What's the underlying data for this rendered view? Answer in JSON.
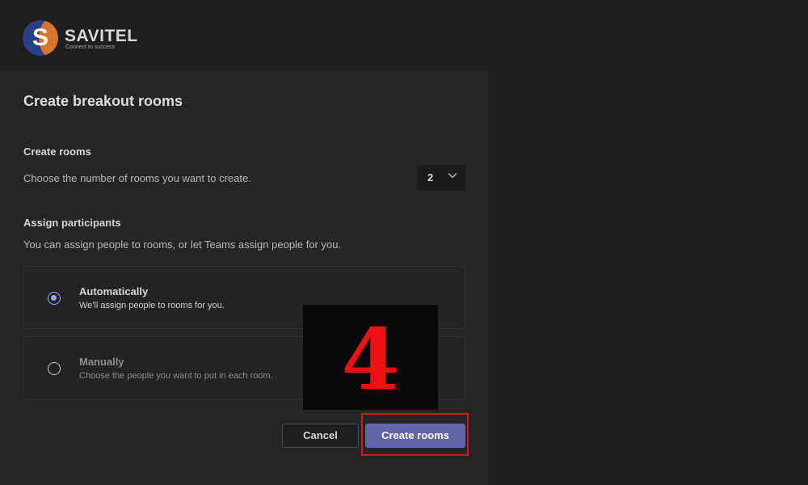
{
  "brand": {
    "logo_letter": "S",
    "name": "SAVITEL",
    "tagline": "Connect to success",
    "colors": {
      "primary": "#2a3f86",
      "secondary": "#d9732d"
    }
  },
  "dialog": {
    "title": "Create breakout rooms",
    "create_rooms": {
      "label": "Create rooms",
      "description": "Choose the number of rooms you want to create.",
      "selected_count": "2",
      "chevron_icon": "chevron-down-icon"
    },
    "assign": {
      "label": "Assign participants",
      "description": "You can assign people to rooms, or let Teams assign people for you.",
      "options": [
        {
          "title": "Automatically",
          "description": "We'll assign people to rooms for you.",
          "selected": true
        },
        {
          "title": "Manually",
          "description": "Choose the people you want to put in each room.",
          "selected": false
        }
      ]
    },
    "buttons": {
      "cancel": "Cancel",
      "create": "Create rooms"
    },
    "accent_color": "#6264a7"
  },
  "annotation": {
    "step_number": "4",
    "highlight_color": "#d01a1a"
  }
}
